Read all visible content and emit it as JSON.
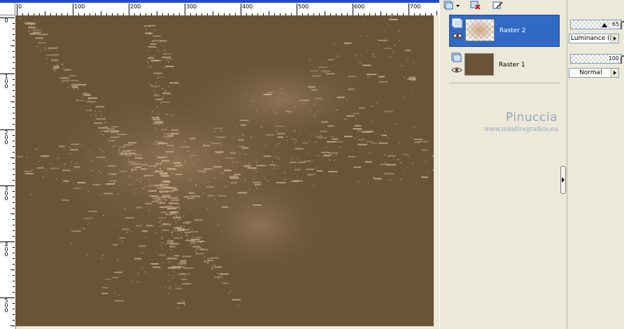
{
  "rulers": {
    "horizontal_labels": [
      "0",
      "100",
      "200",
      "300",
      "400",
      "500",
      "600",
      "700"
    ],
    "vertical_labels": [
      "0",
      "1\n0\n0",
      "2\n0\n0",
      "3\n0\n0",
      "4\n0\n0",
      "5\n0\n0"
    ]
  },
  "layers": [
    {
      "name": "Raster 2",
      "selected": true
    },
    {
      "name": "Raster 1",
      "selected": false
    }
  ],
  "watermark": {
    "title": "Pinuccia",
    "url": "www.maidiregrafica.eu"
  },
  "properties": {
    "top_opacity": "65",
    "top_blend_mode": "Luminance (H)",
    "bottom_opacity": "100",
    "bottom_blend_mode": "Normal"
  },
  "colors": {
    "canvas_base": "#6B5338",
    "canvas_highlight": "#C9B08C",
    "selection": "#316AC5",
    "window_face": "#ECE9D8",
    "watermark": "#8EA6C2"
  },
  "icons": [
    "layer-icon",
    "dropdown-arrow-icon",
    "delete-layer-icon",
    "edit-layer-icon",
    "eye-icon",
    "collapse-arrow-icon"
  ]
}
